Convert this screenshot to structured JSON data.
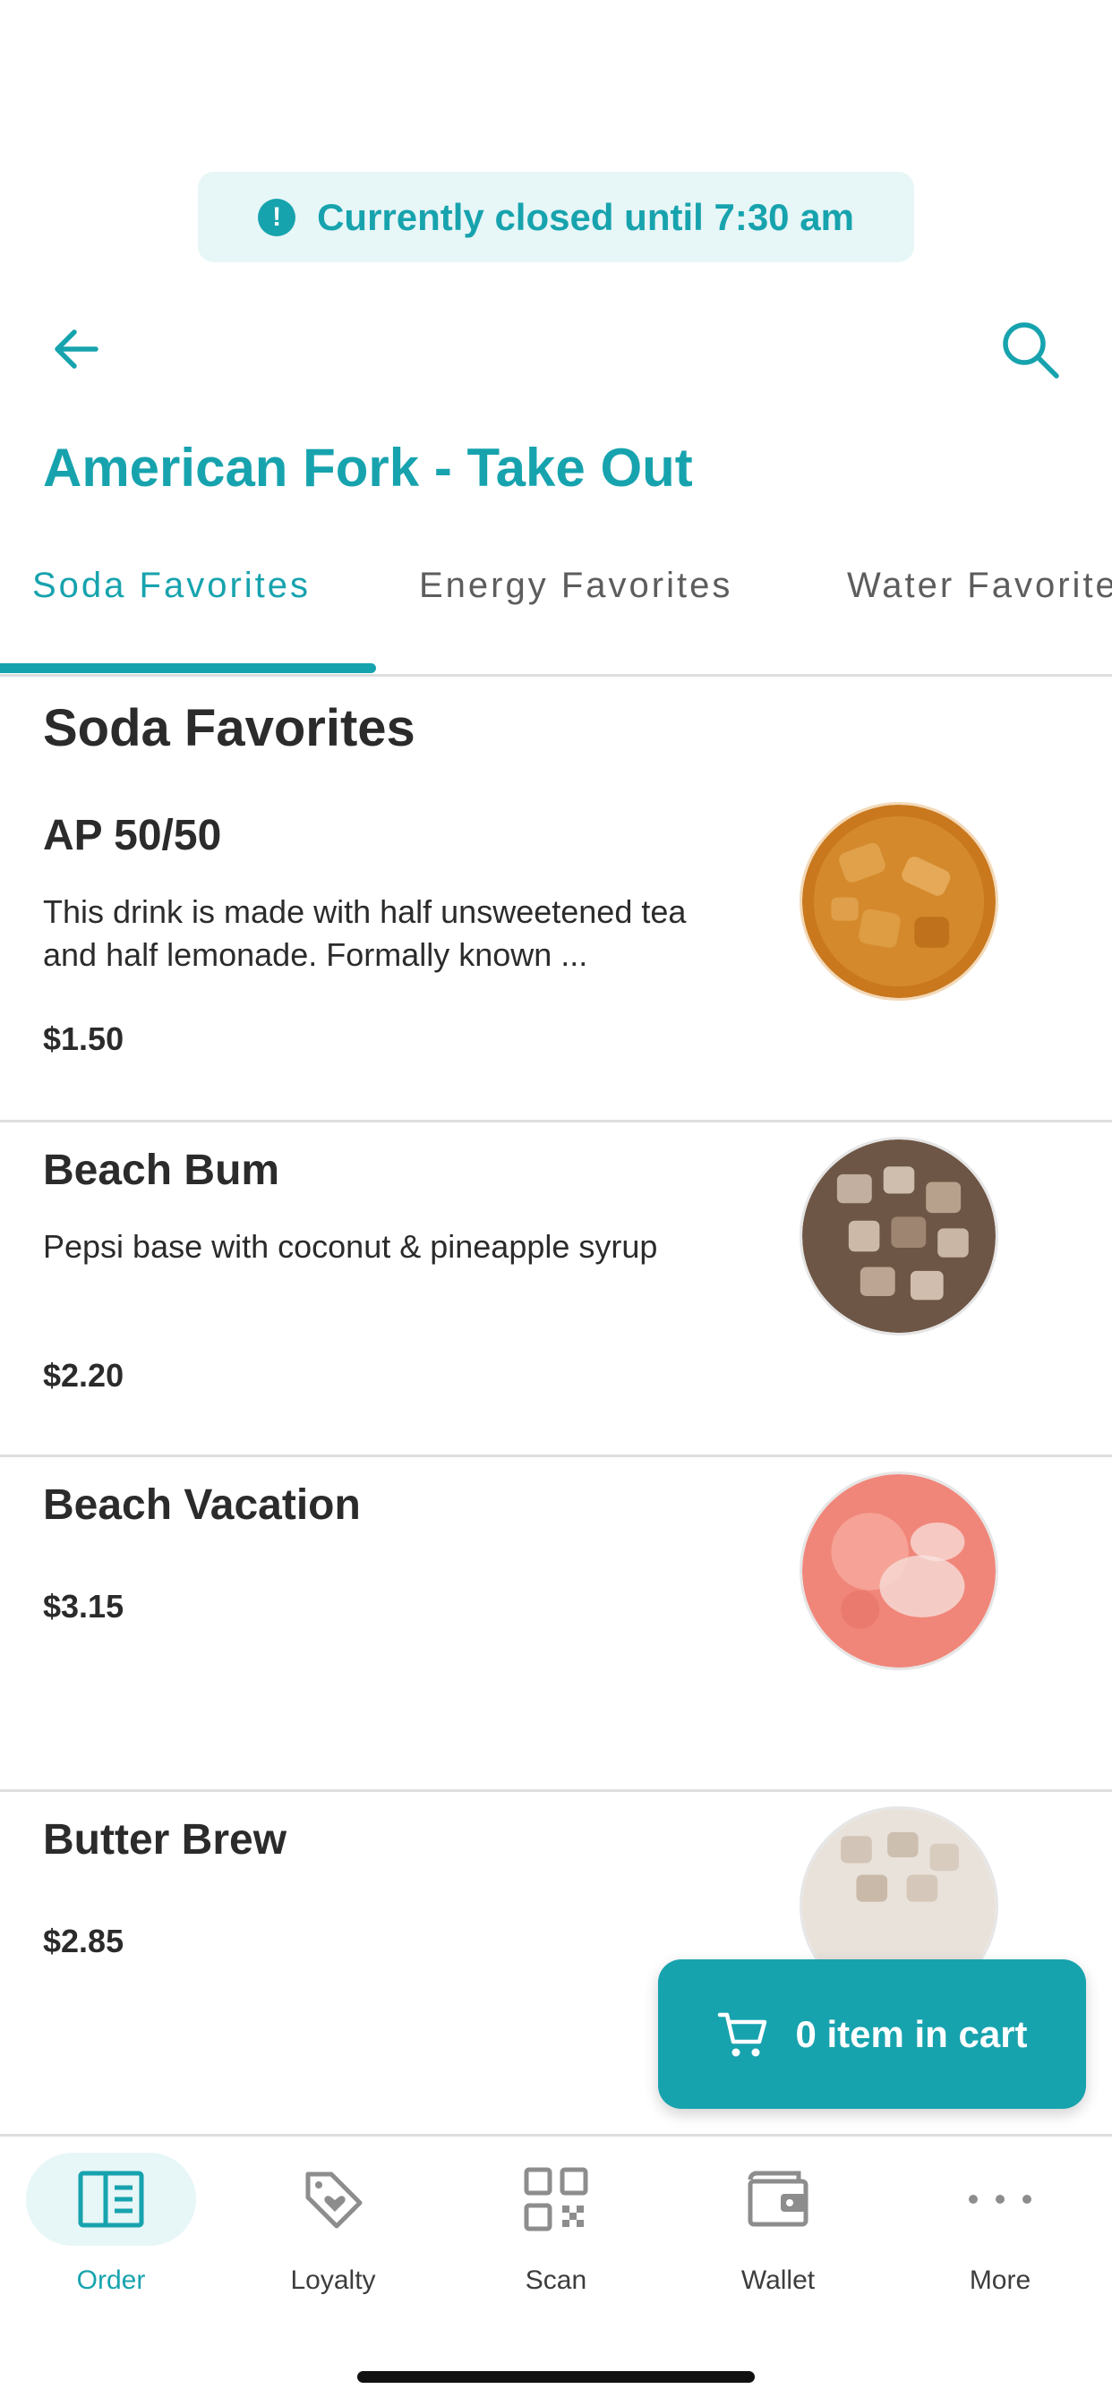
{
  "banner": {
    "text": "Currently closed until 7:30 am",
    "icon": "alert-circle-icon"
  },
  "header": {
    "back_icon": "arrow-left-icon",
    "search_icon": "search-icon"
  },
  "store": {
    "title": "American Fork - Take Out"
  },
  "tabs": [
    {
      "label": "Soda Favorites",
      "active": true
    },
    {
      "label": "Energy Favorites",
      "active": false
    },
    {
      "label": "Water Favorites",
      "active": false
    }
  ],
  "section": {
    "title": "Soda Favorites"
  },
  "items": [
    {
      "name": "AP 50/50",
      "description": "This drink is made with half unsweetened tea and half lemonade. Formally known ...",
      "price": "$1.50",
      "image": "amber-tea-drink"
    },
    {
      "name": "Beach Bum",
      "description": "Pepsi base with coconut & pineapple syrup",
      "price": "$2.20",
      "image": "cola-ice-drink"
    },
    {
      "name": "Beach Vacation",
      "description": "",
      "price": "$3.15",
      "image": "pink-foam-drink"
    },
    {
      "name": "Butter Brew",
      "description": "",
      "price": "$2.85",
      "image": "cream-ice-drink"
    }
  ],
  "cart": {
    "label": "0 item in cart",
    "icon": "cart-icon"
  },
  "nav": [
    {
      "label": "Order",
      "icon": "menu-book-icon",
      "active": true
    },
    {
      "label": "Loyalty",
      "icon": "tag-heart-icon",
      "active": false
    },
    {
      "label": "Scan",
      "icon": "qr-code-icon",
      "active": false
    },
    {
      "label": "Wallet",
      "icon": "wallet-icon",
      "active": false
    },
    {
      "label": "More",
      "icon": "more-dots-icon",
      "active": false
    }
  ],
  "colors": {
    "accent": "#17a3ae",
    "accent_light": "#e7f6f7",
    "text": "#2b2b2b",
    "divider": "#dedede"
  }
}
